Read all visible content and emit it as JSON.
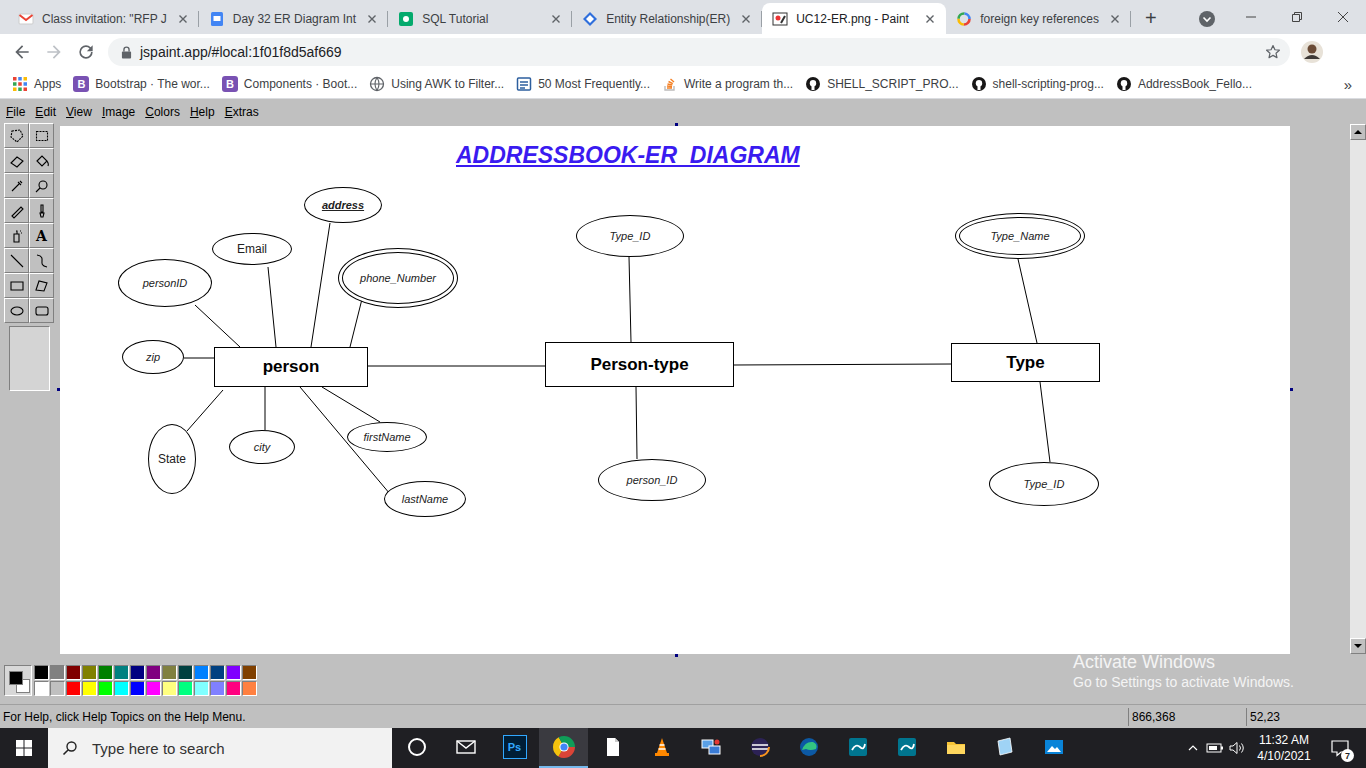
{
  "browser": {
    "tabs": [
      {
        "label": "Class invitation: \"RFP J",
        "icon": "gmail",
        "selected": false
      },
      {
        "label": "Day 32 ER Diagram Int",
        "icon": "slides",
        "selected": false
      },
      {
        "label": "SQL Tutorial",
        "icon": "w3",
        "selected": false
      },
      {
        "label": "Entity Relationship(ER)",
        "icon": "diamond",
        "selected": false
      },
      {
        "label": "UC12-ER.png - Paint",
        "icon": "paint",
        "selected": true
      },
      {
        "label": "foreign key references",
        "icon": "google",
        "selected": false
      }
    ],
    "new_tab": "+",
    "address": "jspaint.app/#local:1f01f8d5af669",
    "forward_disabled": true,
    "bookmarks": [
      {
        "label": "Apps",
        "kind": "apps"
      },
      {
        "label": "Bootstrap · The wor...",
        "kind": "bootstrap",
        "badge": "B"
      },
      {
        "label": "Components · Boot...",
        "kind": "bootstrap",
        "badge": "B"
      },
      {
        "label": "Using AWK to Filter...",
        "kind": "globe"
      },
      {
        "label": "50 Most Frequently...",
        "kind": "tutorial"
      },
      {
        "label": "Write a program th...",
        "kind": "stackoverflow"
      },
      {
        "label": "SHELL_SCRIPT_PRO...",
        "kind": "github"
      },
      {
        "label": "shell-scripting-prog...",
        "kind": "github"
      },
      {
        "label": "AddressBook_Fello...",
        "kind": "github"
      }
    ],
    "more_bookmarks": "»"
  },
  "paint": {
    "menu": [
      "File",
      "Edit",
      "View",
      "Image",
      "Colors",
      "Help",
      "Extras"
    ],
    "tools": [
      {
        "kind": "free-select"
      },
      {
        "kind": "select"
      },
      {
        "kind": "eraser"
      },
      {
        "kind": "fill"
      },
      {
        "kind": "pick-color"
      },
      {
        "kind": "magnifier"
      },
      {
        "kind": "pencil"
      },
      {
        "kind": "brush"
      },
      {
        "kind": "airbrush"
      },
      {
        "kind": "text",
        "glyph": "A"
      },
      {
        "kind": "line"
      },
      {
        "kind": "curve"
      },
      {
        "kind": "rectangle"
      },
      {
        "kind": "polygon"
      },
      {
        "kind": "ellipse"
      },
      {
        "kind": "rounded-rect"
      }
    ],
    "diagram": {
      "title": "ADDRESSBOOK-ER_DIAGRAM",
      "entities": [
        {
          "name": "person"
        },
        {
          "name": "Person-type"
        },
        {
          "name": "Type"
        }
      ],
      "attributes": [
        {
          "name": "address",
          "key": true,
          "multivalued": false,
          "italic": true
        },
        {
          "name": "Email",
          "key": false,
          "multivalued": false,
          "italic": false
        },
        {
          "name": "phone_Number",
          "key": false,
          "multivalued": true,
          "italic": true
        },
        {
          "name": "personID",
          "key": false,
          "multivalued": false,
          "italic": true
        },
        {
          "name": "zip",
          "key": false,
          "multivalued": false,
          "italic": true
        },
        {
          "name": "State",
          "key": false,
          "multivalued": false,
          "italic": false
        },
        {
          "name": "city",
          "key": false,
          "multivalued": false,
          "italic": true
        },
        {
          "name": "firstName",
          "key": false,
          "multivalued": false,
          "italic": true
        },
        {
          "name": "lastName",
          "key": false,
          "multivalued": false,
          "italic": true
        },
        {
          "name": "Type_ID",
          "key": false,
          "multivalued": false,
          "italic": true
        },
        {
          "name": "person_ID",
          "key": false,
          "multivalued": false,
          "italic": true
        },
        {
          "name": "Type_Name",
          "key": false,
          "multivalued": true,
          "italic": true
        },
        {
          "name": "Type_ID",
          "key": false,
          "multivalued": false,
          "italic": true
        }
      ]
    },
    "palette": {
      "primary": "#000000",
      "secondary": "#ffffff",
      "colors": [
        "#000000",
        "#808080",
        "#800000",
        "#808000",
        "#008000",
        "#008080",
        "#000080",
        "#800080",
        "#808040",
        "#004040",
        "#0080ff",
        "#004080",
        "#8000ff",
        "#804000",
        "#ffffff",
        "#c0c0c0",
        "#ff0000",
        "#ffff00",
        "#00ff00",
        "#00ffff",
        "#0000ff",
        "#ff00ff",
        "#ffff80",
        "#00ff80",
        "#80ffff",
        "#8080ff",
        "#ff0080",
        "#ff8040"
      ]
    },
    "status": {
      "help": "For Help, click Help Topics on the Help Menu.",
      "position": "866,368",
      "size": "52,23"
    }
  },
  "watermark": {
    "title": "Activate Windows",
    "subtitle": "Go to Settings to activate Windows."
  },
  "taskbar": {
    "search": "Type here to search",
    "apps": [
      {
        "kind": "cortana",
        "selected": false
      },
      {
        "kind": "mail",
        "selected": false
      },
      {
        "kind": "photoshop",
        "glyph": "Ps",
        "selected": false
      },
      {
        "kind": "chrome",
        "selected": true
      },
      {
        "kind": "file",
        "selected": false
      },
      {
        "kind": "vlc",
        "selected": false
      },
      {
        "kind": "network",
        "selected": false
      },
      {
        "kind": "eclipse",
        "selected": false
      },
      {
        "kind": "edge",
        "selected": false
      },
      {
        "kind": "workbench",
        "selected": false
      },
      {
        "kind": "workbench",
        "selected": false
      },
      {
        "kind": "explorer",
        "selected": false
      },
      {
        "kind": "notepad",
        "selected": false
      },
      {
        "kind": "photos",
        "selected": false
      }
    ],
    "time": "11:32 AM",
    "date": "4/10/2021",
    "notifications": "7"
  }
}
